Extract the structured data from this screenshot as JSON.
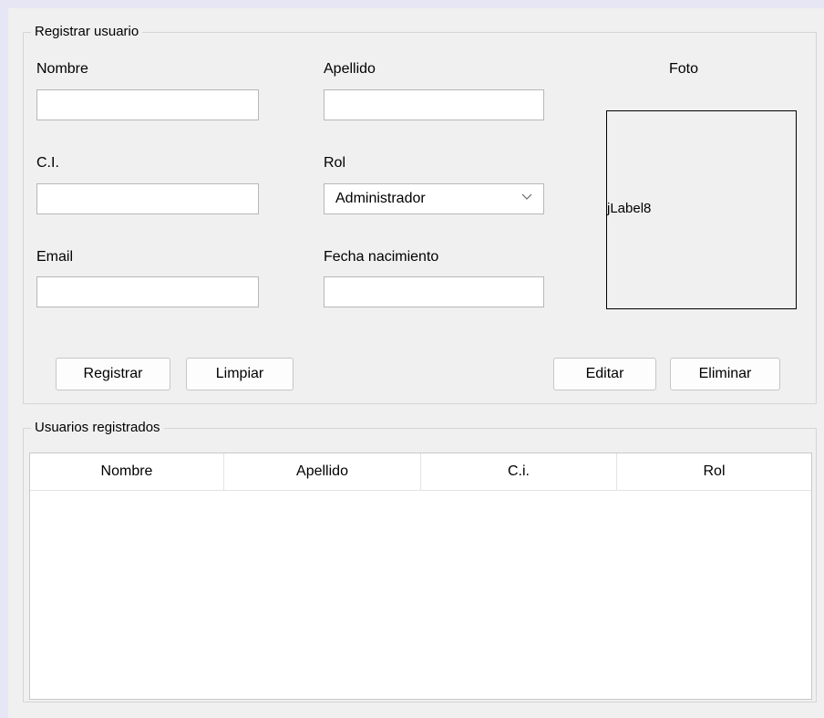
{
  "register_group": {
    "title": "Registrar usuario",
    "labels": {
      "nombre": "Nombre",
      "apellido": "Apellido",
      "ci": "C.I.",
      "rol": "Rol",
      "email": "Email",
      "fecha": "Fecha nacimiento",
      "foto": "Foto"
    },
    "fields": {
      "nombre": "",
      "apellido": "",
      "ci": "",
      "email": "",
      "fecha": ""
    },
    "rol_selected": "Administrador",
    "photo_placeholder": "jLabel8",
    "buttons": {
      "registrar": "Registrar",
      "limpiar": "Limpiar",
      "editar": "Editar",
      "eliminar": "Eliminar"
    }
  },
  "users_group": {
    "title": "Usuarios registrados",
    "columns": [
      "Nombre",
      "Apellido",
      "C.i.",
      "Rol"
    ],
    "rows": []
  }
}
